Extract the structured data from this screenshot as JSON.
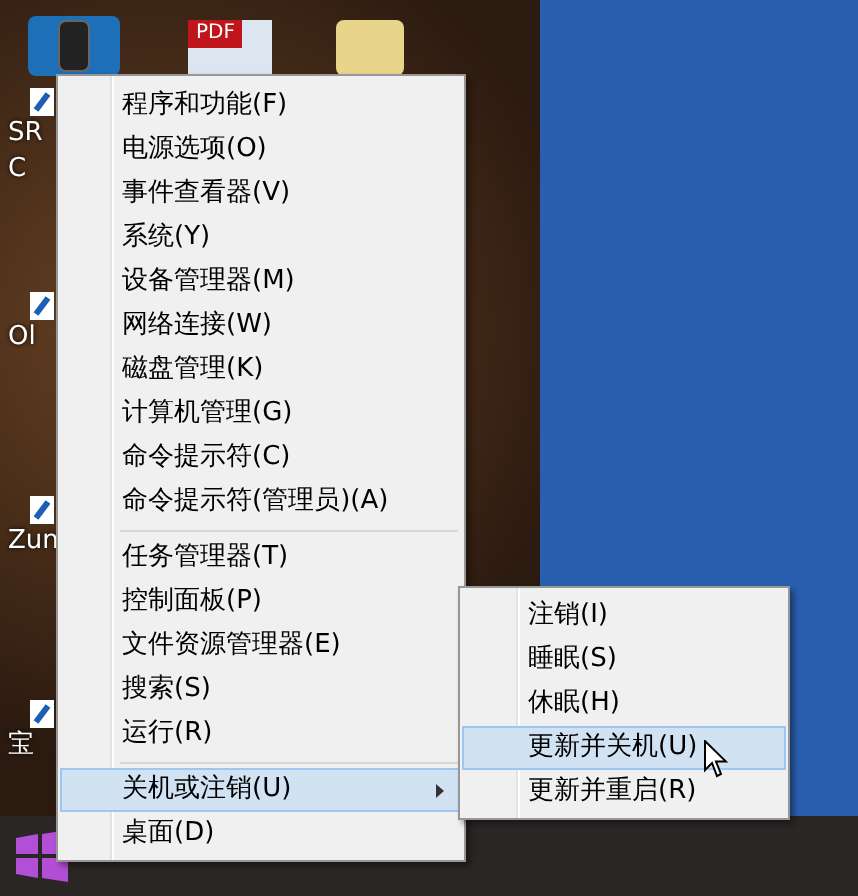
{
  "desktop_icons": [
    {
      "lines": [
        "SR",
        "C"
      ]
    },
    {
      "lines": [
        "Ol"
      ]
    },
    {
      "lines": [
        "Zun"
      ]
    },
    {
      "lines": [
        "宝"
      ]
    }
  ],
  "top_icons": [
    {
      "kind": "phone"
    },
    {
      "kind": "pdf",
      "label": "PDF"
    },
    {
      "kind": "folder"
    }
  ],
  "context_menu": {
    "items": [
      {
        "kind": "item",
        "label": "程序和功能(F)",
        "selected": false,
        "has_submenu": false
      },
      {
        "kind": "item",
        "label": "电源选项(O)",
        "selected": false,
        "has_submenu": false
      },
      {
        "kind": "item",
        "label": "事件查看器(V)",
        "selected": false,
        "has_submenu": false
      },
      {
        "kind": "item",
        "label": "系统(Y)",
        "selected": false,
        "has_submenu": false
      },
      {
        "kind": "item",
        "label": "设备管理器(M)",
        "selected": false,
        "has_submenu": false
      },
      {
        "kind": "item",
        "label": "网络连接(W)",
        "selected": false,
        "has_submenu": false
      },
      {
        "kind": "item",
        "label": "磁盘管理(K)",
        "selected": false,
        "has_submenu": false
      },
      {
        "kind": "item",
        "label": "计算机管理(G)",
        "selected": false,
        "has_submenu": false
      },
      {
        "kind": "item",
        "label": "命令提示符(C)",
        "selected": false,
        "has_submenu": false
      },
      {
        "kind": "item",
        "label": "命令提示符(管理员)(A)",
        "selected": false,
        "has_submenu": false
      },
      {
        "kind": "separator"
      },
      {
        "kind": "item",
        "label": "任务管理器(T)",
        "selected": false,
        "has_submenu": false
      },
      {
        "kind": "item",
        "label": "控制面板(P)",
        "selected": false,
        "has_submenu": false
      },
      {
        "kind": "item",
        "label": "文件资源管理器(E)",
        "selected": false,
        "has_submenu": false
      },
      {
        "kind": "item",
        "label": "搜索(S)",
        "selected": false,
        "has_submenu": false
      },
      {
        "kind": "item",
        "label": "运行(R)",
        "selected": false,
        "has_submenu": false
      },
      {
        "kind": "separator"
      },
      {
        "kind": "item",
        "label": "关机或注销(U)",
        "selected": true,
        "has_submenu": true
      },
      {
        "kind": "item",
        "label": "桌面(D)",
        "selected": false,
        "has_submenu": false
      }
    ]
  },
  "submenu": {
    "items": [
      {
        "label": "注销(I)",
        "selected": false
      },
      {
        "label": "睡眠(S)",
        "selected": false
      },
      {
        "label": "休眠(H)",
        "selected": false
      },
      {
        "label": "更新并关机(U)",
        "selected": true
      },
      {
        "label": "更新并重启(R)",
        "selected": false
      }
    ]
  }
}
